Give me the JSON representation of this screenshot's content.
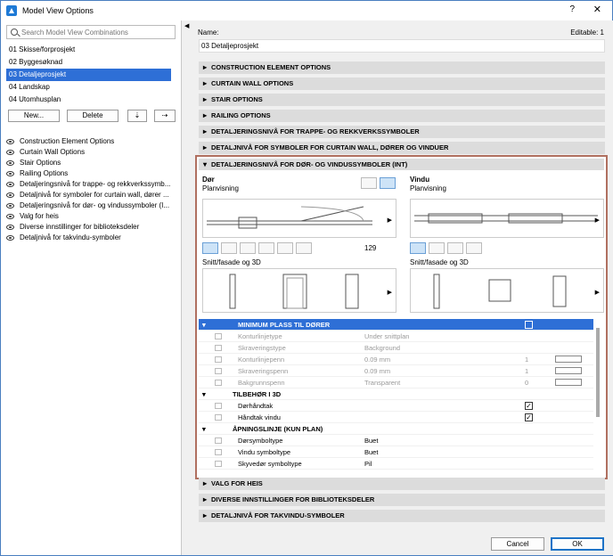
{
  "window": {
    "title": "Model View Options",
    "help": "?",
    "close": "✕"
  },
  "left": {
    "search_placeholder": "Search Model View Combinations",
    "combinations": [
      "01 Skisse/forprosjekt",
      "02 Byggesøknad",
      "03 Detaljeprosjekt",
      "04 Landskap",
      "04 Utomhusplan"
    ],
    "selected_index": 2,
    "buttons": {
      "new": "New...",
      "delete": "Delete"
    },
    "options": [
      "Construction Element Options",
      "Curtain Wall Options",
      "Stair Options",
      "Railing Options",
      "Detaljeringsnivå for trappe- og rekkverkssymb...",
      "Detaljnivå for symboler for curtain wall, dører ...",
      "Detaljeringsnivå for dør- og vindussymboler (I...",
      "Valg for heis",
      "Diverse innstillinger for biblioteksdeler",
      "Detaljnivå for takvindu-symboler"
    ]
  },
  "right": {
    "name_label": "Name:",
    "editable": "Editable: 1",
    "name_value": "03 Detaljeprosjekt",
    "sections_top": [
      "CONSTRUCTION ELEMENT OPTIONS",
      "CURTAIN WALL OPTIONS",
      "STAIR OPTIONS",
      "RAILING OPTIONS",
      "DETALJERINGSNIVÅ FOR TRAPPE- OG REKKVERKSSYMBOLER",
      "DETALJNIVÅ FOR SYMBOLER FOR CURTAIN WALL, DØRER OG VINDUER"
    ],
    "open_section": "DETALJERINGSNIVÅ FOR DØR- OG VINDUSSYMBOLER (INT)",
    "door": {
      "title": "Dør",
      "plan": "Planvisning",
      "section": "Snitt/fasade og 3D",
      "number": "129"
    },
    "window": {
      "title": "Vindu",
      "plan": "Planvisning",
      "section": "Snitt/fasade og 3D"
    },
    "table": [
      {
        "type": "h",
        "label": "MINIMUM PLASS TIL DØRER"
      },
      {
        "type": "dis",
        "label": "Konturlinjetype",
        "value": "Under snittplan"
      },
      {
        "type": "dis",
        "label": "Skraveringstype",
        "value": "Background"
      },
      {
        "type": "dis",
        "label": "Konturlinjepenn",
        "value": "0.09 mm",
        "num": "1"
      },
      {
        "type": "dis",
        "label": "Skraveringspenn",
        "value": "0.09 mm",
        "num": "1"
      },
      {
        "type": "dis",
        "label": "Bakgrunnspenn",
        "value": "Transparent",
        "num": "0"
      },
      {
        "type": "g",
        "label": "TILBEHØR I 3D"
      },
      {
        "type": "c",
        "label": "Dørhåndtak",
        "check": "✓"
      },
      {
        "type": "c",
        "label": "Håndtak vindu",
        "check": "✓"
      },
      {
        "type": "g",
        "label": "ÅPNINGSLINJE (KUN PLAN)"
      },
      {
        "type": "v",
        "label": "Dørsymboltype",
        "value": "Buet"
      },
      {
        "type": "v",
        "label": "Vindu symboltype",
        "value": "Buet"
      },
      {
        "type": "v",
        "label": "Skyvedør symboltype",
        "value": "Pil"
      }
    ],
    "sections_bottom": [
      "VALG FOR HEIS",
      "DIVERSE INNSTILLINGER FOR BIBLIOTEKSDELER",
      "DETALJNIVÅ FOR TAKVINDU-SYMBOLER"
    ],
    "cancel": "Cancel",
    "ok": "OK"
  }
}
